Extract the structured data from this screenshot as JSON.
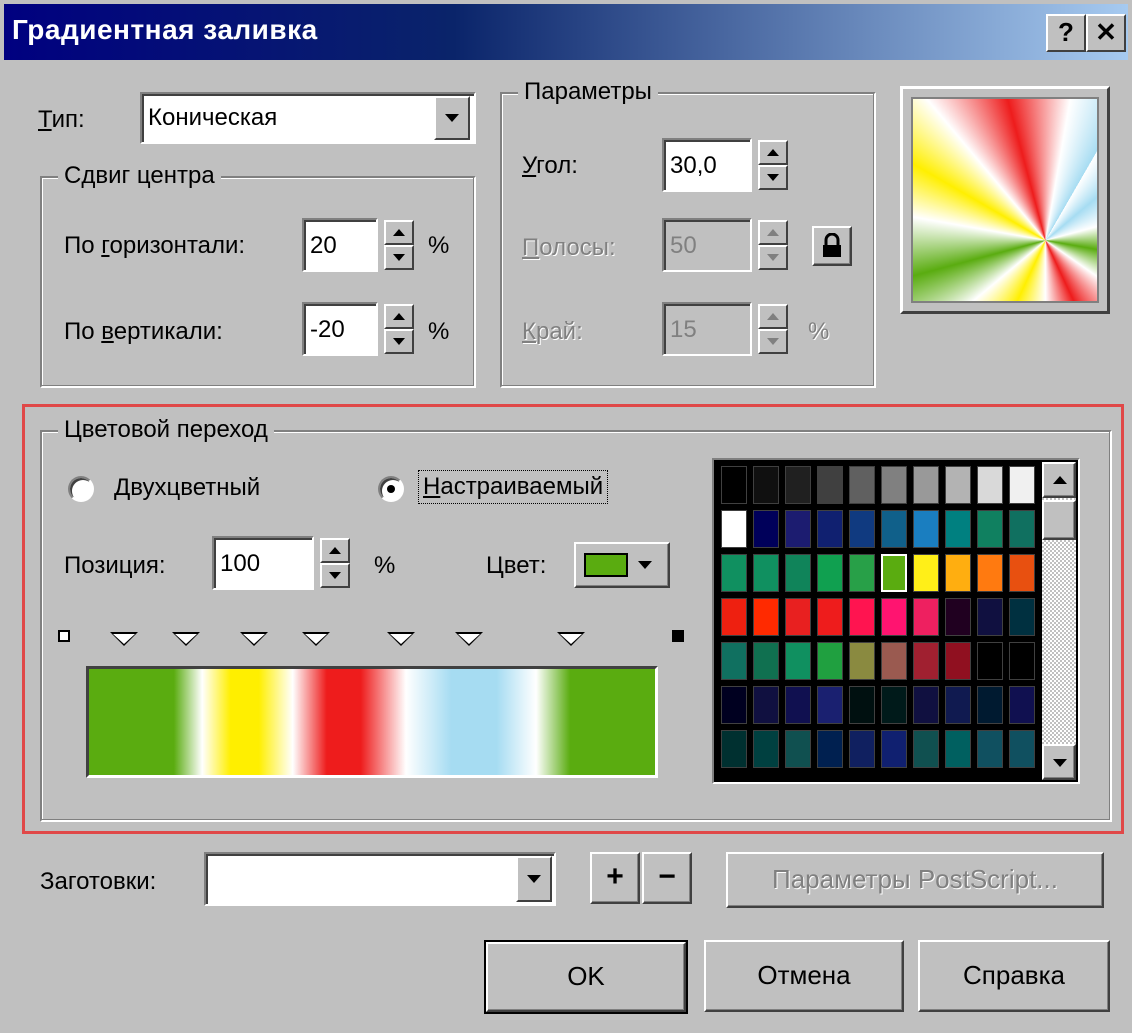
{
  "window": {
    "title": "Градиентная заливка",
    "help_btn": "?",
    "close_btn": "✕"
  },
  "type": {
    "label_u": "Т",
    "label_rest": "ип:",
    "value": "Коническая"
  },
  "center": {
    "legend": "Сдвиг центра",
    "h_pre": "По ",
    "h_u": "г",
    "h_post": "оризонтали:",
    "h_value": "20",
    "h_unit": "%",
    "v_pre": "По ",
    "v_u": "в",
    "v_post": "ертикали:",
    "v_value": "-20",
    "v_unit": "%"
  },
  "params": {
    "legend": "Параметры",
    "angle_u": "У",
    "angle_rest": "гол:",
    "angle_value": "30,0",
    "stripes_u": "П",
    "stripes_rest": "олосы:",
    "stripes_value": "50",
    "edge_u": "К",
    "edge_rest": "рай:",
    "edge_value": "15",
    "edge_unit": "%"
  },
  "blend": {
    "legend": "Цветовой переход",
    "two_color_u": "Д",
    "two_color_rest": "вухцветный",
    "custom_u": "Н",
    "custom_rest": "астраиваемый",
    "position_label": "Позиция:",
    "position_value": "100",
    "position_unit": "%",
    "color_label": "Цвет:",
    "current_color": "#5aac10"
  },
  "gradient": {
    "stops": [
      {
        "pos": 0,
        "color": "#5aac10"
      },
      {
        "pos": 0.15,
        "color": "#5aac10"
      },
      {
        "pos": 0.2,
        "color": "#ffffff"
      },
      {
        "pos": 0.25,
        "color": "#ffef00"
      },
      {
        "pos": 0.3,
        "color": "#ffef00"
      },
      {
        "pos": 0.36,
        "color": "#ffffff"
      },
      {
        "pos": 0.42,
        "color": "#ee1c1c"
      },
      {
        "pos": 0.48,
        "color": "#ee1c1c"
      },
      {
        "pos": 0.56,
        "color": "#ffffff"
      },
      {
        "pos": 0.64,
        "color": "#a6dcf2"
      },
      {
        "pos": 0.72,
        "color": "#a6dcf2"
      },
      {
        "pos": 0.79,
        "color": "#ffffff"
      },
      {
        "pos": 0.85,
        "color": "#5aac10"
      },
      {
        "pos": 1,
        "color": "#5aac10"
      }
    ],
    "markers": [
      0.06,
      0.17,
      0.29,
      0.4,
      0.55,
      0.67,
      0.85
    ]
  },
  "palette": {
    "rows": [
      [
        "#000000",
        "#101010",
        "#202020",
        "#404040",
        "#606060",
        "#808080",
        "#999999",
        "#b3b3b3",
        "#d9d9d9",
        "#f0f0f0"
      ],
      [
        "#ffffff",
        "#00005a",
        "#1c1c70",
        "#102070",
        "#103a80",
        "#10608a",
        "#1a7ec0",
        "#008080",
        "#108060",
        "#107060"
      ],
      [
        "#109060",
        "#109060",
        "#10845a",
        "#10a050",
        "#28a048",
        "#5aac10",
        "#ffef18",
        "#ffae10",
        "#ff7a10",
        "#e85010"
      ],
      [
        "#ee2010",
        "#ff2a00",
        "#e82020",
        "#ee1c1c",
        "#ff1450",
        "#ff1470",
        "#ee2060",
        "#200020",
        "#101040",
        "#003040"
      ],
      [
        "#107060",
        "#107050",
        "#109060",
        "#20a040",
        "#8a8a40",
        "#9a5a50",
        "#a02030",
        "#901020",
        "#000000",
        "#000000"
      ],
      [
        "#000020",
        "#101040",
        "#101050",
        "#1a2070",
        "#001010",
        "#001a1a",
        "#101040",
        "#101a50",
        "#001a30",
        "#101050"
      ],
      [
        "#003030",
        "#004040",
        "#105050",
        "#002050",
        "#102060",
        "#102070",
        "#105050",
        "#006060",
        "#105060",
        "#105060"
      ]
    ],
    "selected": "#5aac10"
  },
  "presets": {
    "label": "Заготовки:",
    "value": "",
    "add": "+",
    "remove": "−",
    "postscript": "Параметры PostScript..."
  },
  "buttons": {
    "ok": "OK",
    "cancel": "Отмена",
    "help": "Справка"
  }
}
